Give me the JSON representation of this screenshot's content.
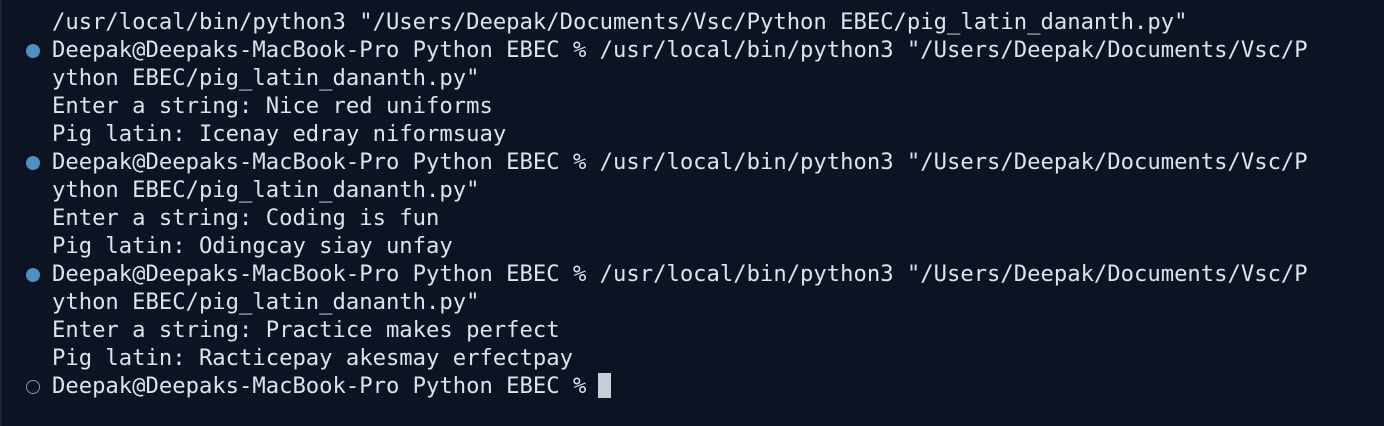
{
  "terminal": {
    "lines": [
      {
        "text": "/usr/local/bin/python3 \"/Users/Deepak/Documents/Vsc/Python EBEC/pig_latin_dananth.py\""
      },
      {
        "text": "Deepak@Deepaks-MacBook-Pro Python EBEC % /usr/local/bin/python3 \"/Users/Deepak/Documents/Vsc/P",
        "marker": "success"
      },
      {
        "text": "ython EBEC/pig_latin_dananth.py\""
      },
      {
        "text": "Enter a string: Nice red uniforms"
      },
      {
        "text": "Pig latin: Icenay edray niformsuay"
      },
      {
        "text": "Deepak@Deepaks-MacBook-Pro Python EBEC % /usr/local/bin/python3 \"/Users/Deepak/Documents/Vsc/P",
        "marker": "success"
      },
      {
        "text": "ython EBEC/pig_latin_dananth.py\""
      },
      {
        "text": "Enter a string: Coding is fun"
      },
      {
        "text": "Pig latin: Odingcay siay unfay"
      },
      {
        "text": "Deepak@Deepaks-MacBook-Pro Python EBEC % /usr/local/bin/python3 \"/Users/Deepak/Documents/Vsc/P",
        "marker": "success"
      },
      {
        "text": "ython EBEC/pig_latin_dananth.py\""
      },
      {
        "text": "Enter a string: Practice makes perfect"
      },
      {
        "text": "Pig latin: Racticepay akesmay erfectpay"
      },
      {
        "text": "Deepak@Deepaks-MacBook-Pro Python EBEC %",
        "marker": "idle"
      }
    ]
  },
  "colors": {
    "background": "#0c1424",
    "text": "#dde3ec",
    "success_marker": "#4e90be",
    "idle_marker": "#8a93a3",
    "cursor": "#c9ced6"
  }
}
